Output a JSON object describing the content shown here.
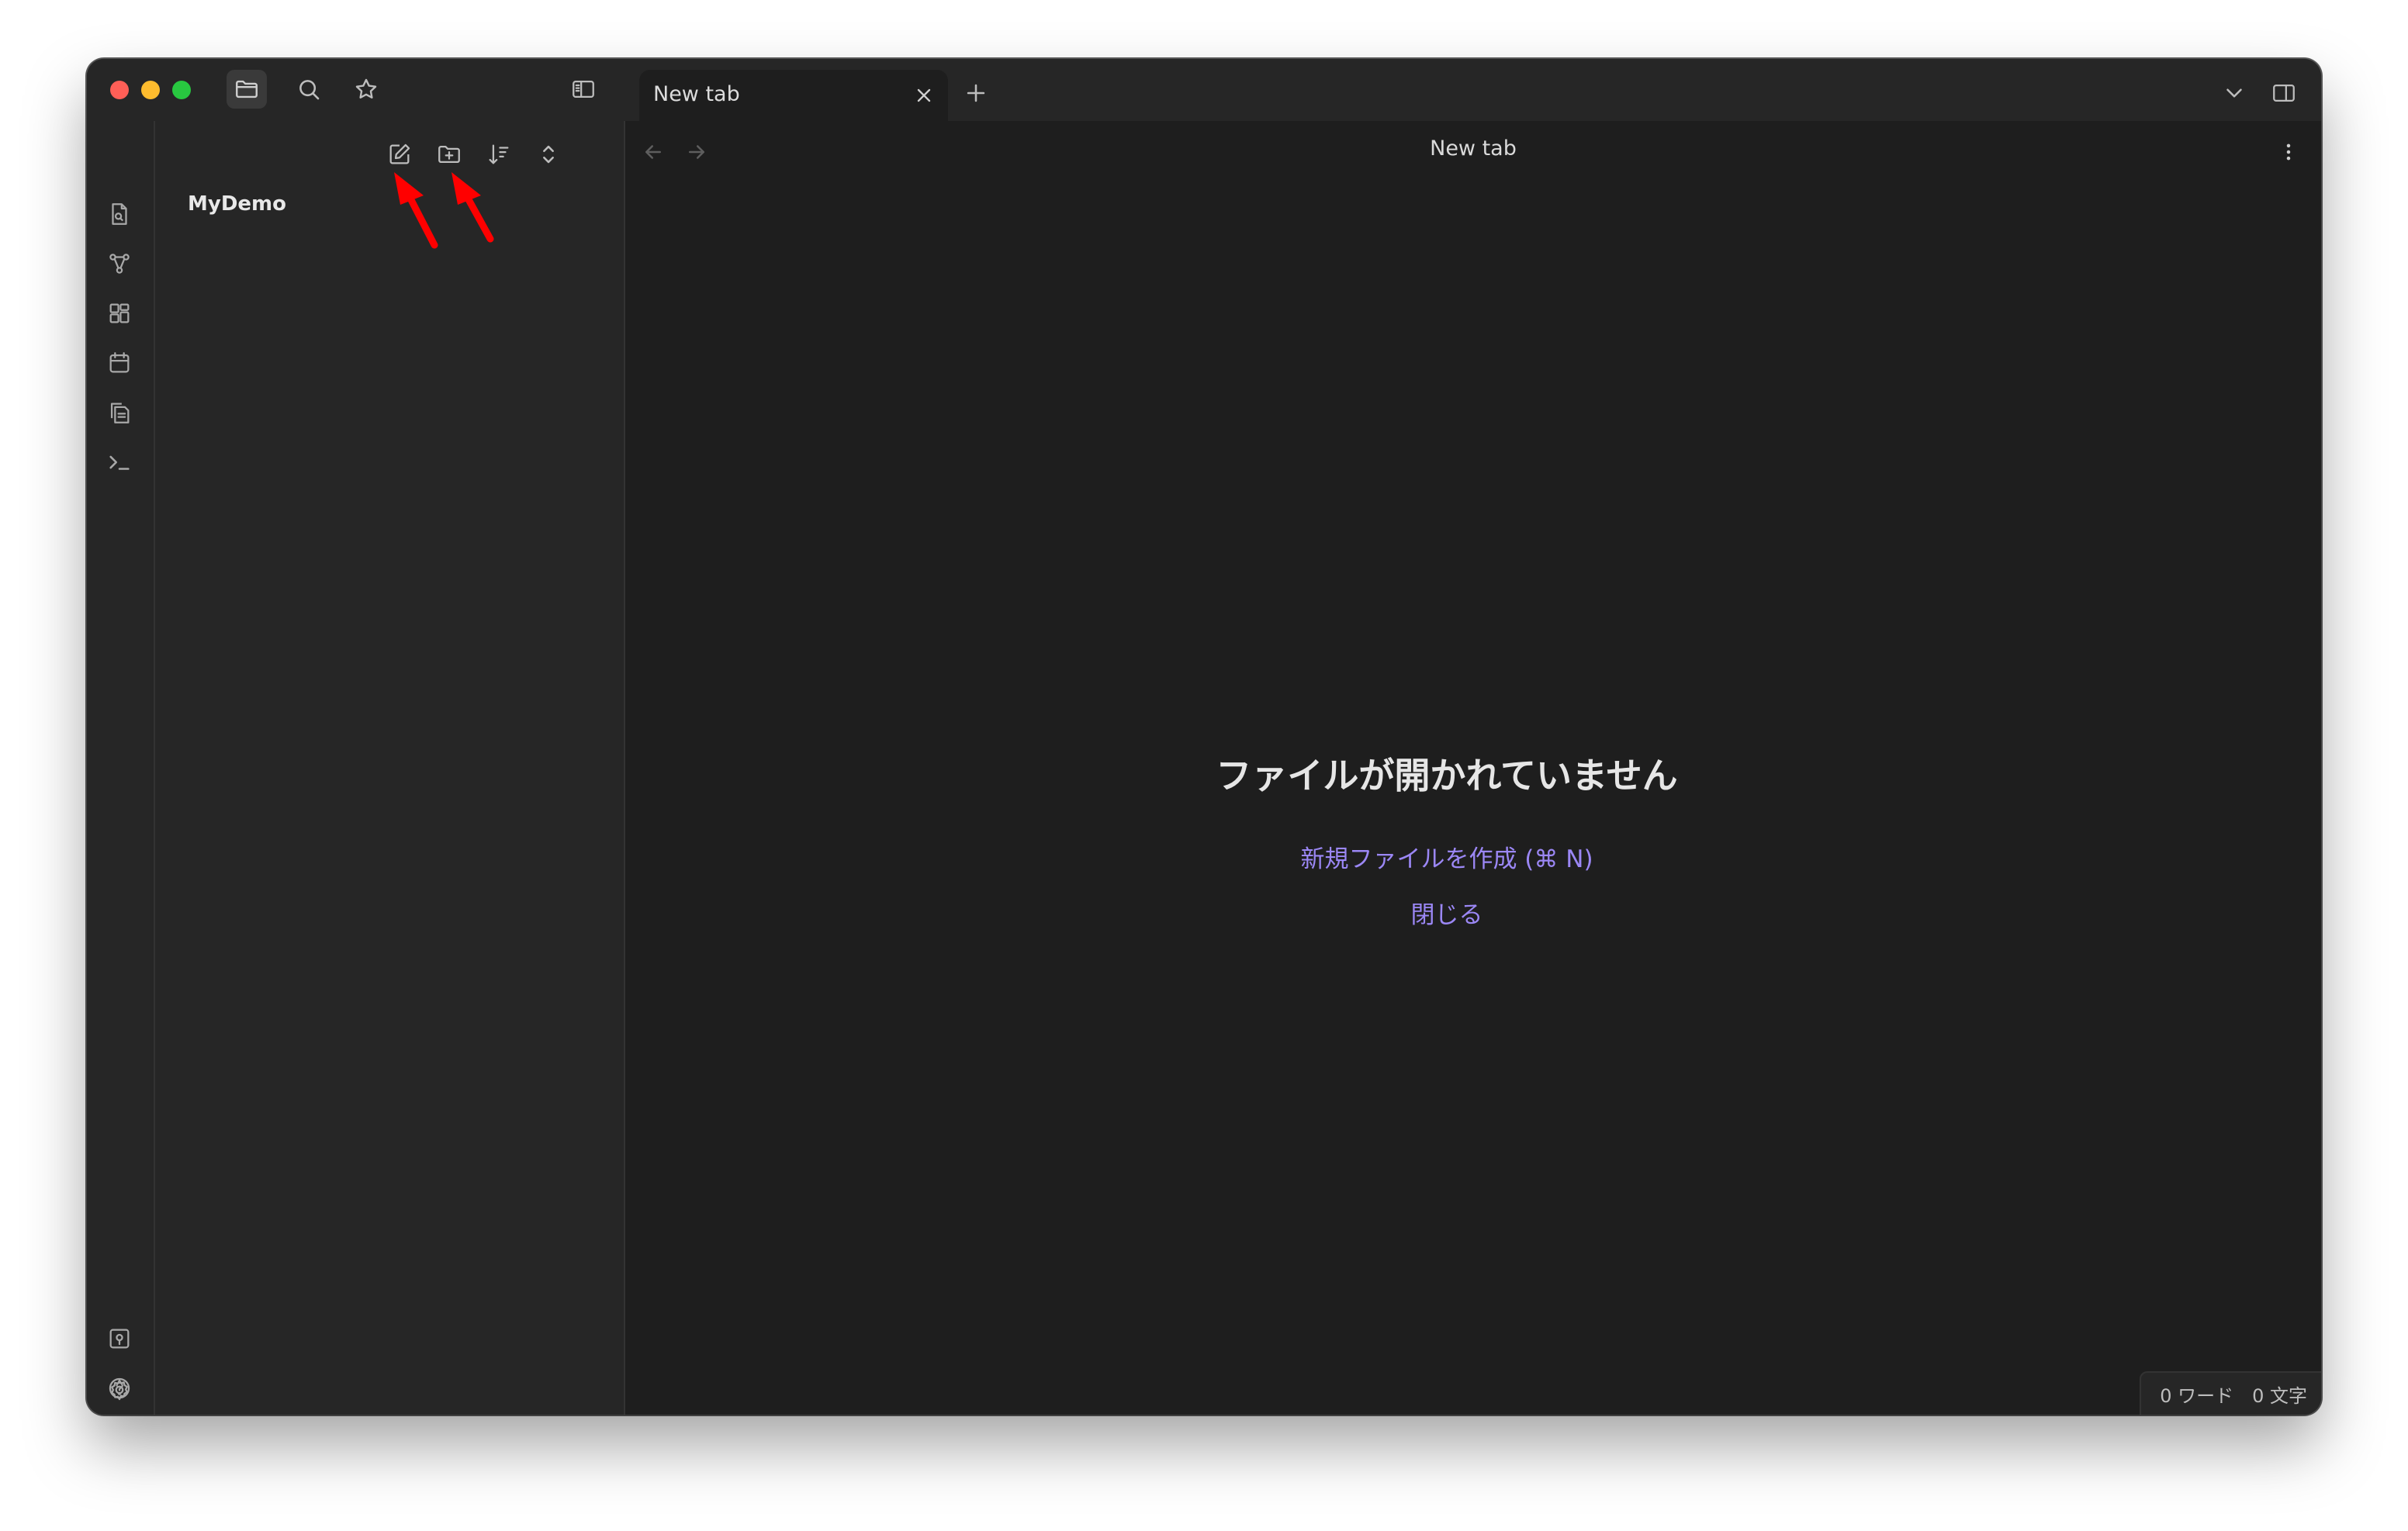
{
  "titlebar": {
    "icons": [
      "folder-icon",
      "search-icon",
      "star-icon",
      "sidebar-toggle-icon"
    ],
    "active_tab": {
      "label": "New tab",
      "close_icon": "close-icon"
    },
    "new_tab_icon": "plus-icon",
    "right_icons": [
      "chevron-down-icon",
      "right-sidebar-icon"
    ]
  },
  "ribbon": {
    "top_icons": [
      "quick-switcher-icon",
      "graph-view-icon",
      "canvas-icon",
      "calendar-icon",
      "templates-icon",
      "command-palette-icon"
    ],
    "bottom_icons": [
      "vault-icon",
      "help-icon",
      "settings-icon"
    ]
  },
  "file_explorer": {
    "nav_actions": [
      "new-note-icon",
      "new-folder-icon",
      "sort-icon",
      "collapse-icon"
    ],
    "vault_name": "MyDemo",
    "annotation_color": "#ff0000"
  },
  "main": {
    "title": "New tab",
    "empty_state": {
      "title": "ファイルが開かれていません",
      "create_link": "新規ファイルを作成 (⌘ N)",
      "close_link": "閉じる"
    },
    "accent_color": "#9b87f5"
  },
  "status_bar": {
    "words": "0 ワード",
    "chars": "0 文字"
  }
}
